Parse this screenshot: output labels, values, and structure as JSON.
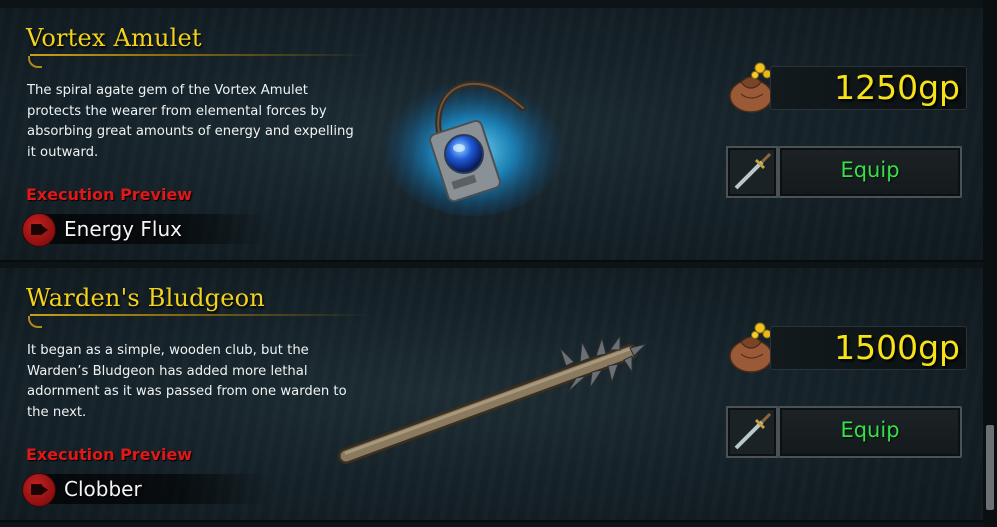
{
  "items": [
    {
      "title": "Vortex Amulet",
      "description": "The spiral agate gem of the Vortex Amulet protects the wearer from elemental forces by absorbing great amounts of energy and expelling it outward.",
      "execution_label": "Execution Preview",
      "execution_name": "Energy Flux",
      "price": "1250gp",
      "equip_label": "Equip",
      "art_icon": "amulet-icon"
    },
    {
      "title": "Warden's Bludgeon",
      "description": "It began as a simple, wooden club, but the Warden’s Bludgeon has added more lethal adornment as it was passed from one warden to the next.",
      "execution_label": "Execution Preview",
      "execution_name": "Clobber",
      "price": "1500gp",
      "equip_label": "Equip",
      "art_icon": "spiked-club-icon"
    }
  ],
  "colors": {
    "title": "#f2d21a",
    "execution_label": "#e01818",
    "price": "#f6e216",
    "equip": "#36e04a"
  }
}
